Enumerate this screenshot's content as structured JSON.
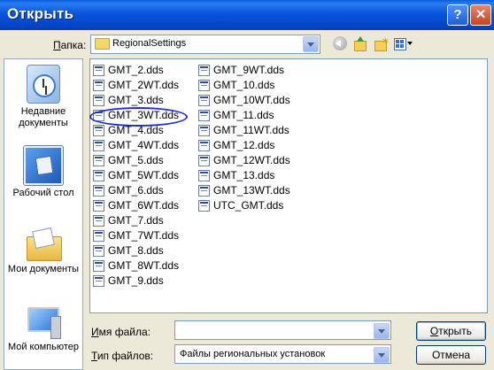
{
  "window": {
    "title": "Открыть",
    "help_label": "?",
    "close_label": "✕"
  },
  "toolbar": {
    "look_in_label": "Папка:",
    "look_in_value": "RegionalSettings",
    "icons": [
      "back-icon",
      "up-one-level-icon",
      "new-folder-icon",
      "views-menu-icon"
    ]
  },
  "places": [
    {
      "label": "Недавние документы",
      "icon": "recent-documents-icon"
    },
    {
      "label": "Рабочий стол",
      "icon": "desktop-icon"
    },
    {
      "label": "Мои документы",
      "icon": "my-documents-icon"
    },
    {
      "label": "Мой компьютер",
      "icon": "my-computer-icon"
    }
  ],
  "files_col1": [
    "GMT_2.dds",
    "GMT_2WT.dds",
    "GMT_3.dds",
    "GMT_3WT.dds",
    "GMT_4.dds",
    "GMT_4WT.dds",
    "GMT_5.dds",
    "GMT_5WT.dds",
    "GMT_6.dds",
    "GMT_6WT.dds",
    "GMT_7.dds",
    "GMT_7WT.dds",
    "GMT_8.dds",
    "GMT_8WT.dds",
    "GMT_9.dds"
  ],
  "files_col2": [
    "GMT_9WT.dds",
    "GMT_10.dds",
    "GMT_10WT.dds",
    "GMT_11.dds",
    "GMT_11WT.dds",
    "GMT_12.dds",
    "GMT_12WT.dds",
    "GMT_13.dds",
    "GMT_13WT.dds",
    "UTC_GMT.dds"
  ],
  "highlighted_file": "GMT_3WT.dds",
  "file_name": {
    "label": "Имя файла:",
    "value": ""
  },
  "file_type": {
    "label": "Тип файлов:",
    "value": "Файлы региональных установок"
  },
  "buttons": {
    "open": "Открыть",
    "cancel": "Отмена"
  },
  "colors": {
    "title_bar": "#0855dd",
    "dialog_bg": "#ece9d8",
    "annotation_circle": "#1d2fd0"
  }
}
